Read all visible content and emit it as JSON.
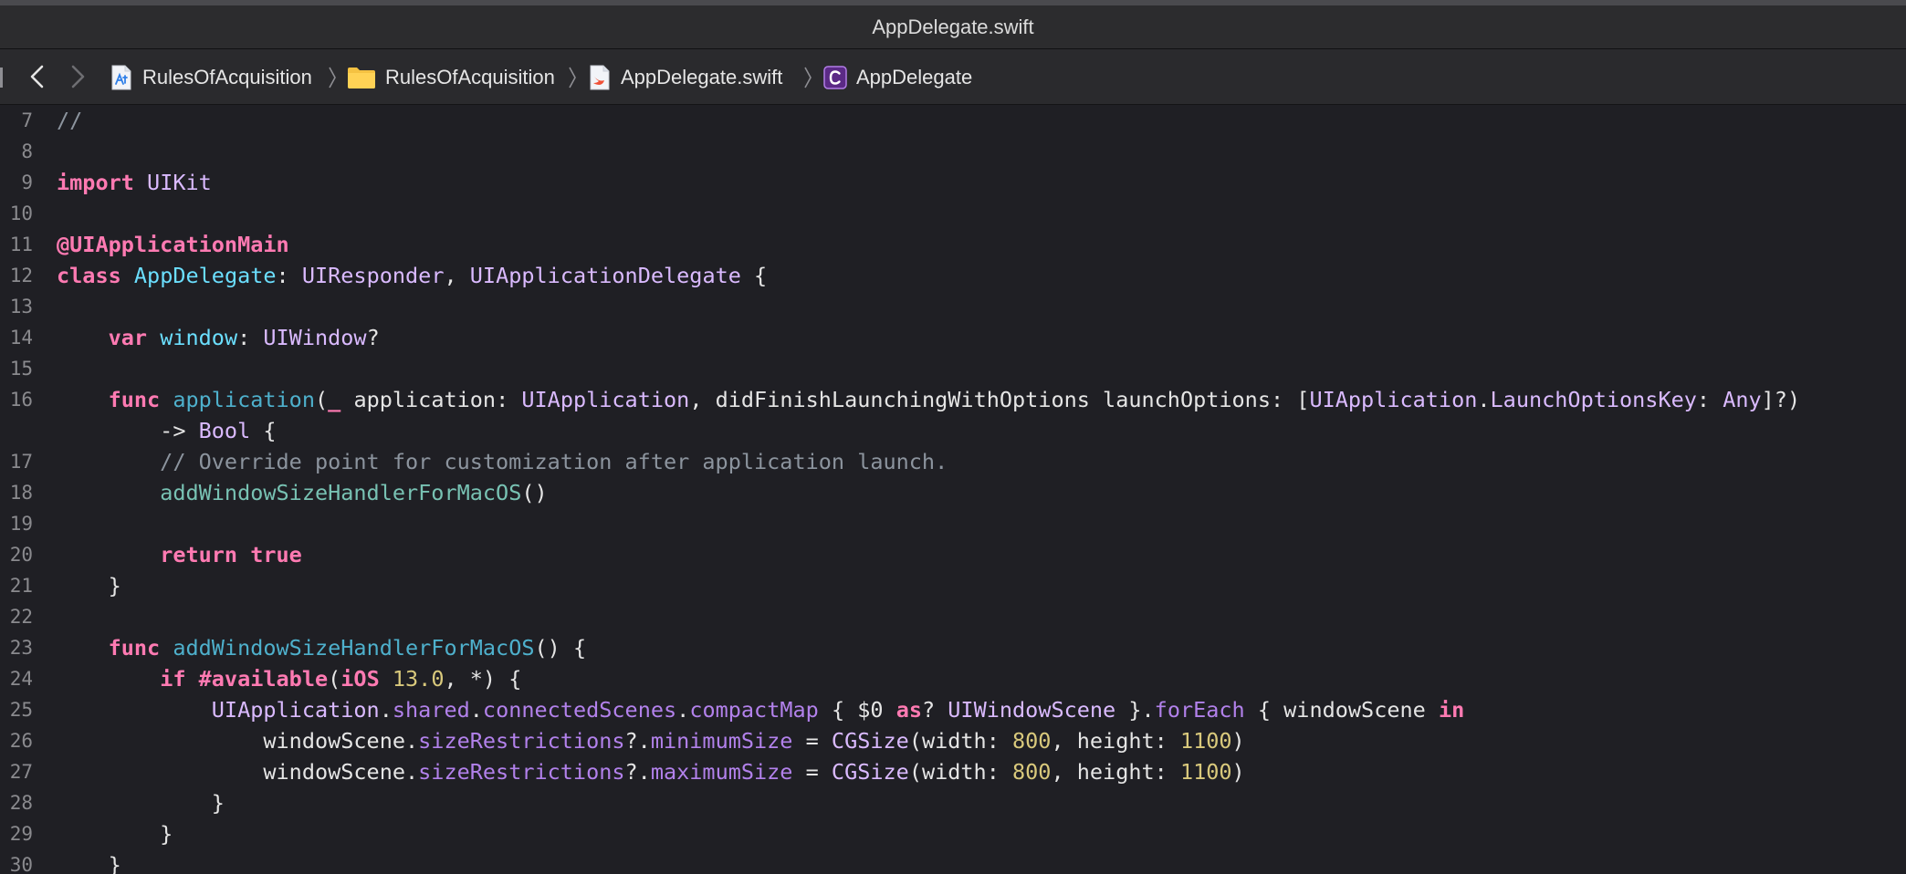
{
  "window": {
    "title": "AppDelegate.swift"
  },
  "breadcrumb": {
    "items": [
      {
        "label": "RulesOfAcquisition",
        "icon": "project-icon"
      },
      {
        "label": "RulesOfAcquisition",
        "icon": "folder-icon"
      },
      {
        "label": "AppDelegate.swift",
        "icon": "swift-file-icon"
      },
      {
        "label": "AppDelegate",
        "icon": "class-icon"
      }
    ]
  },
  "editor": {
    "line_numbers": [
      "7",
      "8",
      "9",
      "10",
      "11",
      "12",
      "13",
      "14",
      "15",
      "16",
      "",
      "17",
      "18",
      "19",
      "20",
      "21",
      "22",
      "23",
      "24",
      "25",
      "26",
      "27",
      "28",
      "29",
      "30"
    ],
    "lines": [
      "//",
      "",
      "import UIKit",
      "",
      "@UIApplicationMain",
      "class AppDelegate: UIResponder, UIApplicationDelegate {",
      "",
      "    var window: UIWindow?",
      "",
      "    func application(_ application: UIApplication, didFinishLaunchingWithOptions launchOptions: [UIApplication.LaunchOptionsKey: Any]?)",
      "        -> Bool {",
      "        // Override point for customization after application launch.",
      "        addWindowSizeHandlerForMacOS()",
      "",
      "        return true",
      "    }",
      "",
      "    func addWindowSizeHandlerForMacOS() {",
      "        if #available(iOS 13.0, *) {",
      "            UIApplication.shared.connectedScenes.compactMap { $0 as? UIWindowScene }.forEach { windowScene in",
      "                windowScene.sizeRestrictions?.minimumSize = CGSize(width: 800, height: 1100)",
      "                windowScene.sizeRestrictions?.maximumSize = CGSize(width: 800, height: 1100)",
      "            }",
      "        }",
      "    }"
    ]
  },
  "colors": {
    "background": "#1f1f24",
    "keyword": "#ff7ab2",
    "type": "#dabaff",
    "declaration": "#6bdfff",
    "number": "#d9c97c",
    "comment": "#8c949e"
  }
}
